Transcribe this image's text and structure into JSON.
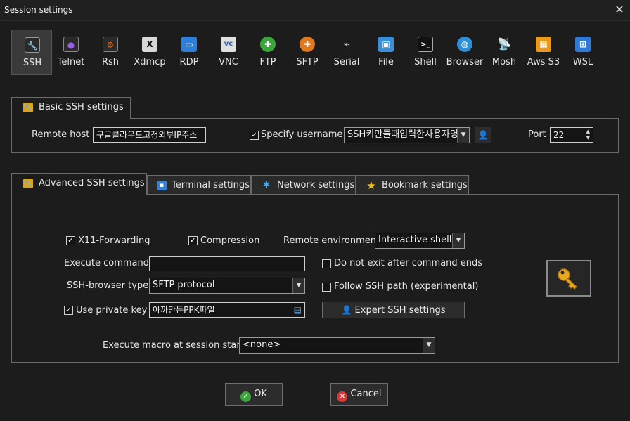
{
  "window": {
    "title": "Session settings"
  },
  "toolbar": {
    "items": [
      {
        "label": "SSH",
        "icon": "ssh-key-icon",
        "color": "#d9a520"
      },
      {
        "label": "Telnet",
        "icon": "telnet-icon",
        "color": "#8a4fd0"
      },
      {
        "label": "Rsh",
        "icon": "rsh-icon",
        "color": "#c8641e"
      },
      {
        "label": "Xdmcp",
        "icon": "xdmcp-icon",
        "color": "#6a6a6a"
      },
      {
        "label": "RDP",
        "icon": "rdp-icon",
        "color": "#2f7fd6"
      },
      {
        "label": "VNC",
        "icon": "vnc-icon",
        "color": "#d8d8d8"
      },
      {
        "label": "FTP",
        "icon": "ftp-icon",
        "color": "#3aa53a"
      },
      {
        "label": "SFTP",
        "icon": "sftp-icon",
        "color": "#e0781e"
      },
      {
        "label": "Serial",
        "icon": "serial-icon",
        "color": "#8c8c8c"
      },
      {
        "label": "File",
        "icon": "file-icon",
        "color": "#3a90d8"
      },
      {
        "label": "Shell",
        "icon": "shell-icon",
        "color": "#3a3a3a"
      },
      {
        "label": "Browser",
        "icon": "browser-icon",
        "color": "#2e8fd8"
      },
      {
        "label": "Mosh",
        "icon": "mosh-icon",
        "color": "#2f86d0"
      },
      {
        "label": "Aws S3",
        "icon": "aws-s3-icon",
        "color": "#e89a1e"
      },
      {
        "label": "WSL",
        "icon": "wsl-icon",
        "color": "#2f7ad6"
      }
    ]
  },
  "basic": {
    "tab_label": "Basic SSH settings",
    "remote_host_label": "Remote host *",
    "remote_host_value": "구글클라우드고정외부IP주소",
    "specify_username_label": "Specify username",
    "specify_username_checked": true,
    "username_value": "SSH키만들때입력한사용자명",
    "port_label": "Port",
    "port_value": "22"
  },
  "tabs": [
    {
      "label": "Advanced SSH settings",
      "icon": "wrench-icon",
      "color": "#d9a520"
    },
    {
      "label": "Terminal settings",
      "icon": "terminal-icon",
      "color": "#3a7fd0"
    },
    {
      "label": "Network settings",
      "icon": "network-icon",
      "color": "#4aa8e8"
    },
    {
      "label": "Bookmark settings",
      "icon": "star-icon",
      "color": "#f0c020"
    }
  ],
  "advanced": {
    "x11_label": "X11-Forwarding",
    "x11_checked": true,
    "compression_label": "Compression",
    "compression_checked": true,
    "remote_env_label": "Remote environment:",
    "remote_env_value": "Interactive shell",
    "execute_command_label": "Execute command:",
    "execute_command_value": "",
    "no_exit_label": "Do not exit after command ends",
    "no_exit_checked": false,
    "ssh_browser_label": "SSH-browser type:",
    "ssh_browser_value": "SFTP protocol",
    "follow_path_label": "Follow SSH path (experimental)",
    "follow_path_checked": false,
    "private_key_label": "Use private key",
    "private_key_checked": true,
    "private_key_value": "아까만든PPK파일",
    "expert_button_label": "Expert SSH settings",
    "macro_label": "Execute macro at session start:",
    "macro_value": "<none>"
  },
  "footer": {
    "ok_label": "OK",
    "cancel_label": "Cancel",
    "ok_color": "#3aa53a",
    "cancel_color": "#d83a3a"
  }
}
